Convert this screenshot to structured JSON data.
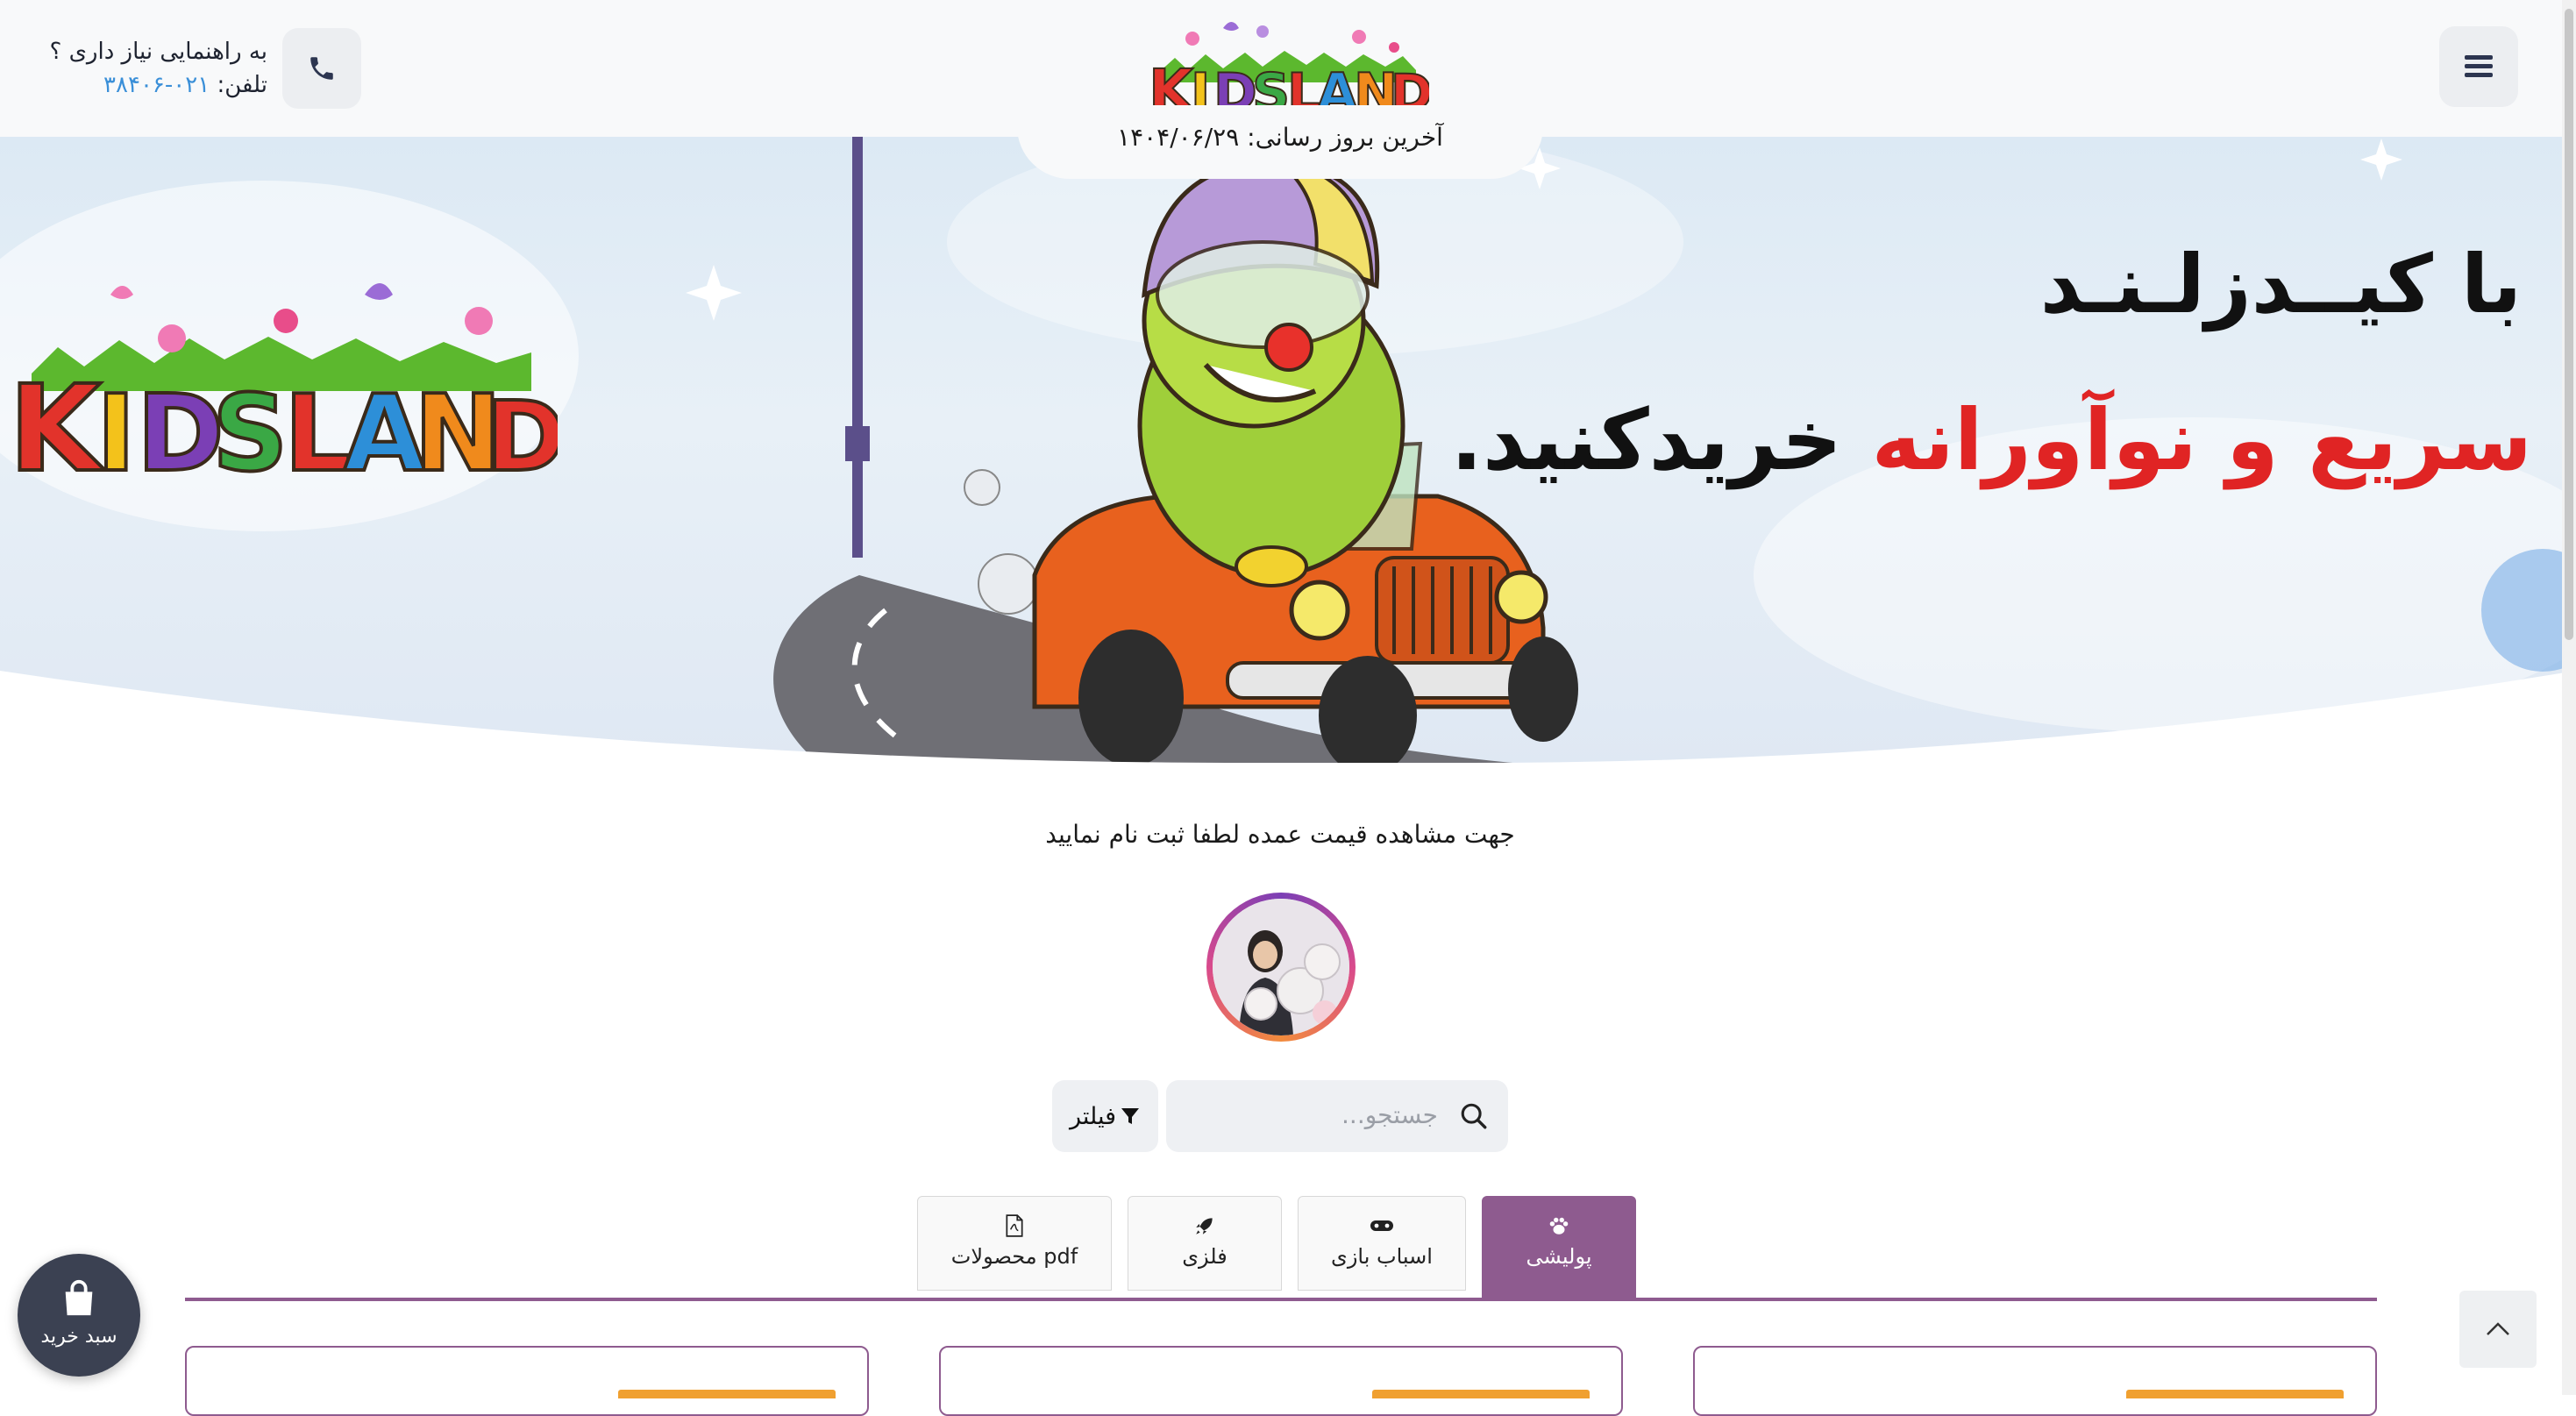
{
  "header": {
    "help_text": "به راهنمایی نیاز داری ؟",
    "phone_label": "تلفن:",
    "phone_number": "۰۲۱-۳۸۴۰۶",
    "update_label": "آخرین بروز رسانی: ۱۴۰۴/۰۶/۲۹",
    "logo_text": "KIDSLAND"
  },
  "banner": {
    "line1": "با کیــدزلـنـد",
    "line2_red": "سریع و نوآورانه",
    "line2_black": "خریدکنید."
  },
  "notice": "جهت مشاهده قیمت عمده لطفا ثبت نام نمایید",
  "search": {
    "placeholder": "جستجو..."
  },
  "filter_label": "فیلتر",
  "tabs": [
    {
      "label": "پولیشی",
      "icon": "paw-icon",
      "active": true
    },
    {
      "label": "اسباب بازی",
      "icon": "gamepad-icon",
      "active": false
    },
    {
      "label": "فلزی",
      "icon": "rocket-icon",
      "active": false
    },
    {
      "label": "pdf محصولات",
      "icon": "pdf-file-icon",
      "active": false
    }
  ],
  "cart_label": "سبد خرید",
  "colors": {
    "accent": "#8e5b8f",
    "badge": "#f0a030",
    "cart": "#3b4152",
    "banner_red": "#e02424"
  }
}
